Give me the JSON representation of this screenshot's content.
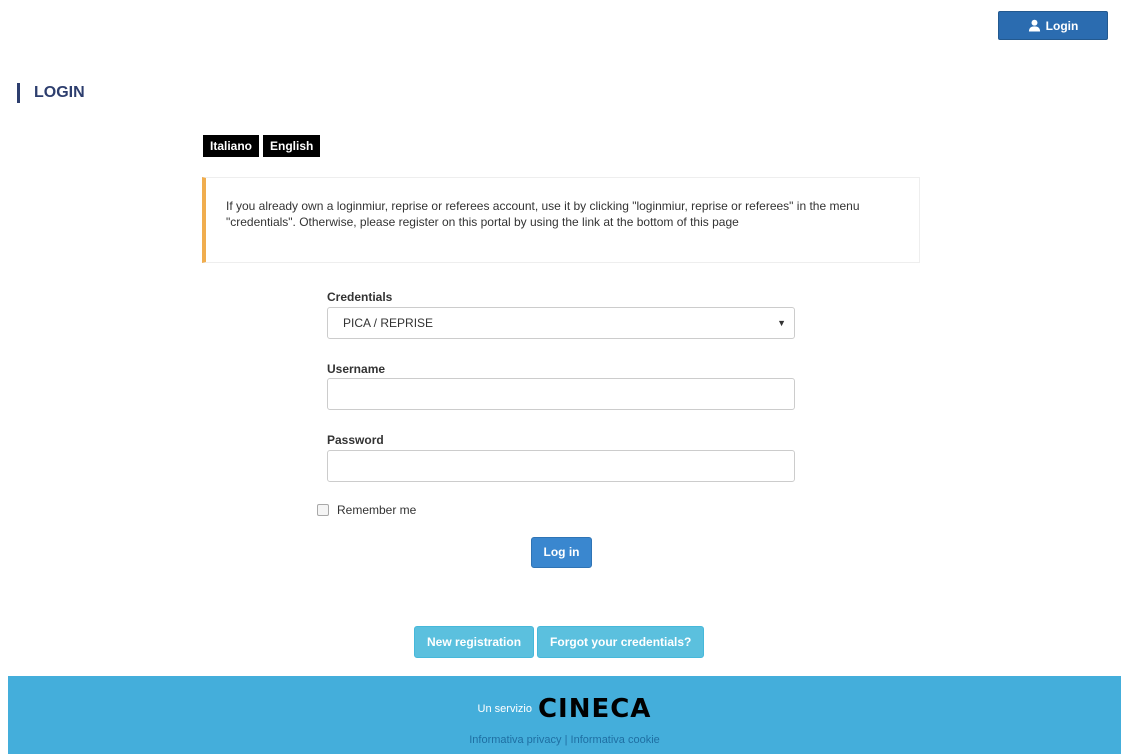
{
  "header": {
    "login_button_label": "Login",
    "login_icon": "user-icon"
  },
  "page": {
    "title": "LOGIN"
  },
  "languages": [
    "Italiano",
    "English"
  ],
  "notice": {
    "text": "If you already own a loginmiur, reprise or referees account, use it by clicking \"loginmiur, reprise or referees\" in the menu \"credentials\". Otherwise, please register on this portal by using the link at the bottom of this page",
    "accent_color": "#f0ad4e"
  },
  "form": {
    "credentials_label": "Credentials",
    "credentials_value": "PICA / REPRISE",
    "username_label": "Username",
    "username_value": "",
    "password_label": "Password",
    "password_value": "",
    "remember_label": "Remember me",
    "submit_label": "Log in"
  },
  "actions": {
    "new_registration": "New registration",
    "forgot_credentials": "Forgot your credentials?"
  },
  "footer": {
    "prefix": "Un servizio",
    "brand": "CINECA",
    "privacy_link": "Informativa privacy",
    "separator": "|",
    "cookie_link": "Informativa cookie",
    "background_color": "#44aedb"
  }
}
